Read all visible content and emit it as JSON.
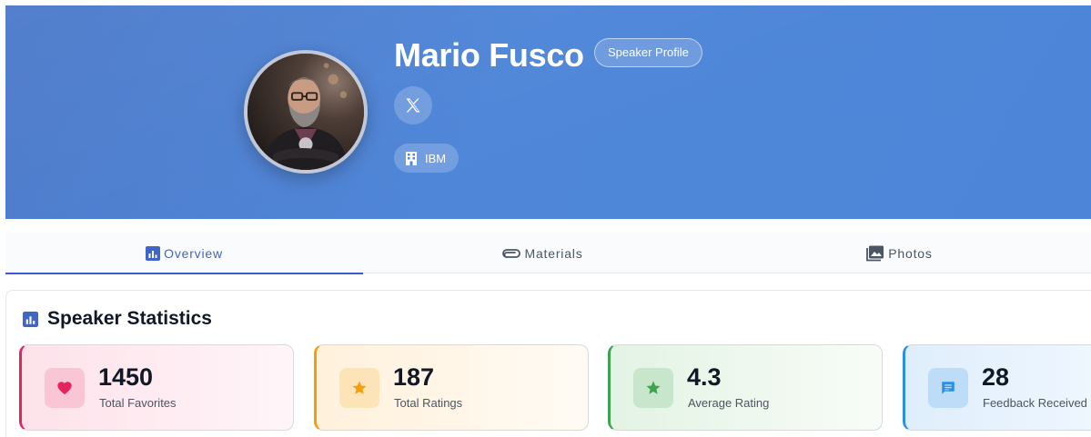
{
  "header": {
    "name": "Mario Fusco",
    "role_badge": "Speaker Profile",
    "company": "IBM",
    "social": {
      "icon": "x-logo-icon"
    }
  },
  "tabs": [
    {
      "label": "Overview",
      "icon": "chart-icon",
      "active": true
    },
    {
      "label": "Materials",
      "icon": "paperclip-icon",
      "active": false
    },
    {
      "label": "Photos",
      "icon": "image-icon",
      "active": false
    }
  ],
  "stats": {
    "title": "Speaker Statistics",
    "cards": [
      {
        "value": "1450",
        "label": "Total Favorites",
        "icon": "heart-icon",
        "color": "#e3245f"
      },
      {
        "value": "187",
        "label": "Total Ratings",
        "icon": "star-icon",
        "color": "#f59e0b"
      },
      {
        "value": "4.3",
        "label": "Average Rating",
        "icon": "star-icon",
        "color": "#3fa34d"
      },
      {
        "value": "28",
        "label": "Feedback Received",
        "icon": "feedback-icon",
        "color": "#2b8fe6"
      }
    ]
  },
  "colors": {
    "hero": "#4f86d8",
    "accent": "#3b5bcc"
  }
}
